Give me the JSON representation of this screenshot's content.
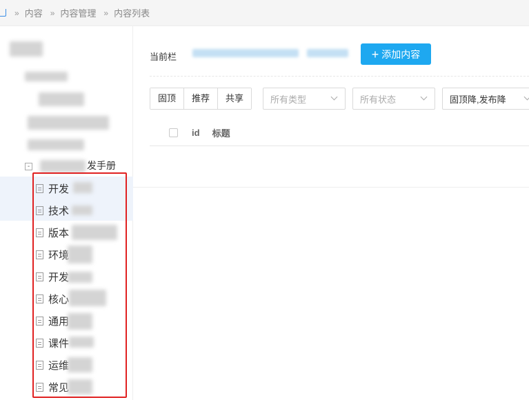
{
  "breadcrumb": {
    "items": [
      "内容",
      "内容管理",
      "内容列表"
    ],
    "separator": "»"
  },
  "tree": {
    "parent_label_suffix": "发手册",
    "expander_symbol": "-",
    "items": [
      {
        "label": "开发"
      },
      {
        "label": "技术"
      },
      {
        "label": "版本"
      },
      {
        "label": "环境"
      },
      {
        "label": "开发"
      },
      {
        "label": "核心"
      },
      {
        "label": "通用"
      },
      {
        "label": "课件"
      },
      {
        "label": "运维"
      },
      {
        "label": "常见"
      }
    ],
    "highlight_color": "#e02020"
  },
  "toolbar": {
    "current_label": "当前栏",
    "add_button_label": "添加内容",
    "add_button_icon": "plus-icon",
    "accent_color": "#1ea8f0"
  },
  "filters": {
    "group_buttons": [
      "固顶",
      "推荐",
      "共享"
    ],
    "type_select": {
      "placeholder": "所有类型"
    },
    "status_select": {
      "placeholder": "所有状态"
    },
    "sort_select": {
      "value": "固顶降,发布降"
    }
  },
  "table": {
    "columns": [
      "id",
      "标题"
    ]
  }
}
